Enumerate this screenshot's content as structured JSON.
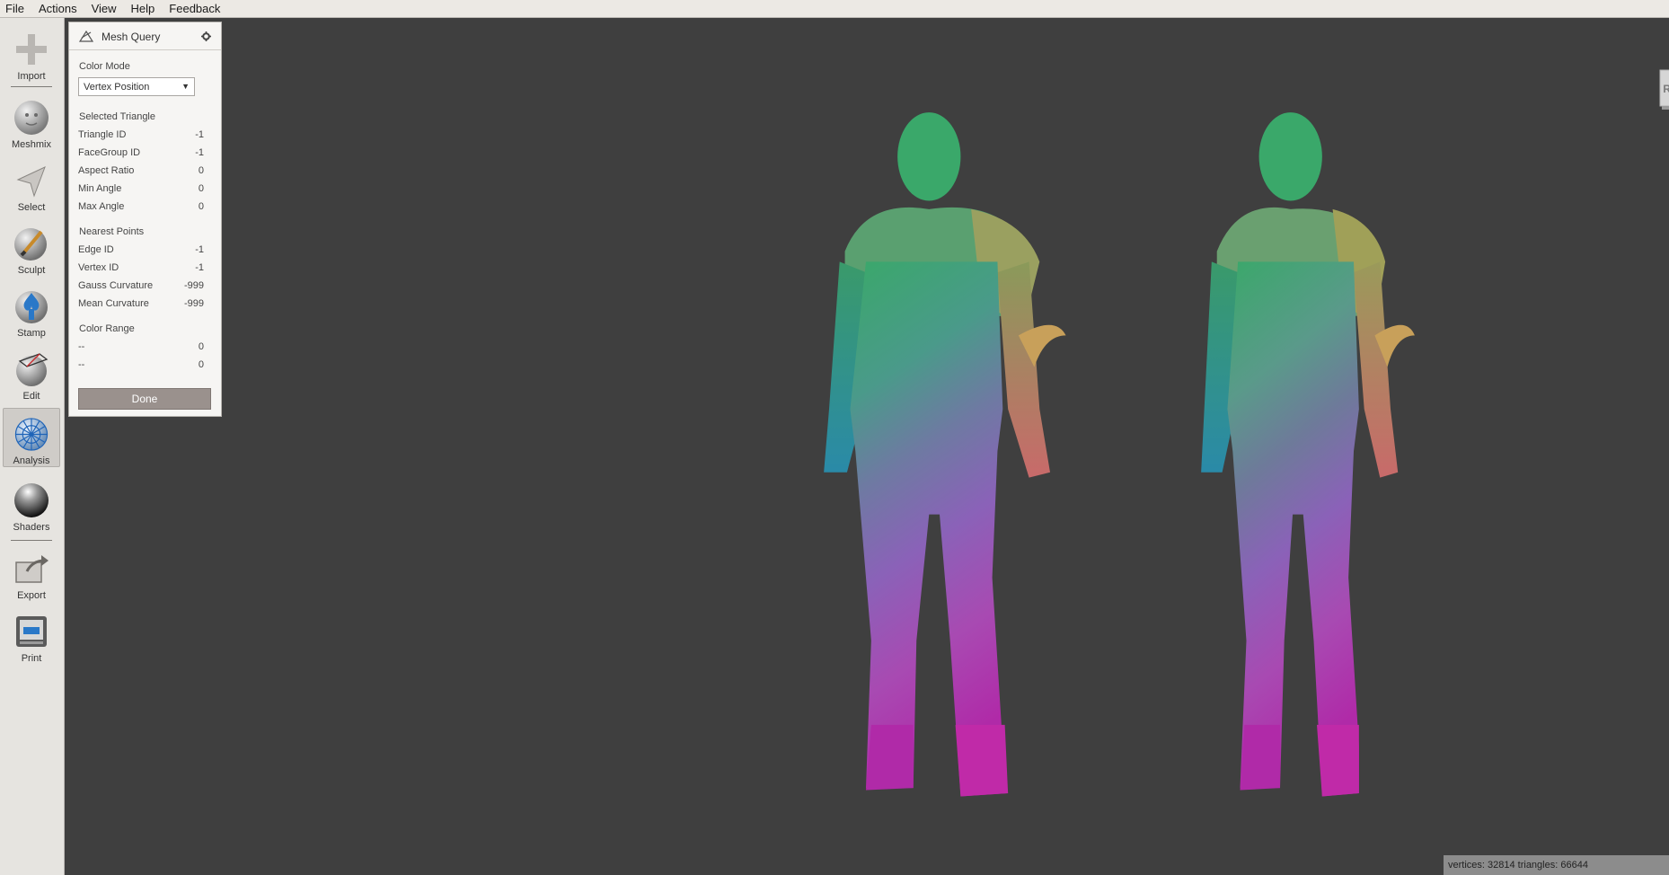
{
  "menu": [
    "File",
    "Actions",
    "View",
    "Help",
    "Feedback"
  ],
  "toolbar": {
    "import": "Import",
    "meshmix": "Meshmix",
    "select": "Select",
    "sculpt": "Sculpt",
    "stamp": "Stamp",
    "edit": "Edit",
    "analysis": "Analysis",
    "shaders": "Shaders",
    "export": "Export",
    "print": "Print",
    "active": "analysis"
  },
  "panel": {
    "title": "Mesh Query",
    "color_mode_label": "Color Mode",
    "color_mode_value": "Vertex Position",
    "selected_triangle_label": "Selected Triangle",
    "triangle_rows": [
      {
        "label": "Triangle ID",
        "value": "-1"
      },
      {
        "label": "FaceGroup ID",
        "value": "-1"
      },
      {
        "label": "Aspect Ratio",
        "value": "0"
      },
      {
        "label": "Min Angle",
        "value": "0"
      },
      {
        "label": "Max Angle",
        "value": "0"
      }
    ],
    "nearest_points_label": "Nearest Points",
    "nearest_rows": [
      {
        "label": "Edge ID",
        "value": "-1"
      },
      {
        "label": "Vertex ID",
        "value": "-1"
      },
      {
        "label": "Gauss Curvature",
        "value": "-999"
      },
      {
        "label": "Mean Curvature",
        "value": "-999"
      }
    ],
    "color_range_label": "Color Range",
    "range_rows": [
      {
        "label": "--",
        "value": "0"
      },
      {
        "label": "--",
        "value": "0"
      }
    ],
    "done_label": "Done"
  },
  "viewport": {
    "view_cube_label": "RIGHT",
    "status": "vertices: 32814 triangles: 66644",
    "background_color": "#3f3f3f"
  }
}
